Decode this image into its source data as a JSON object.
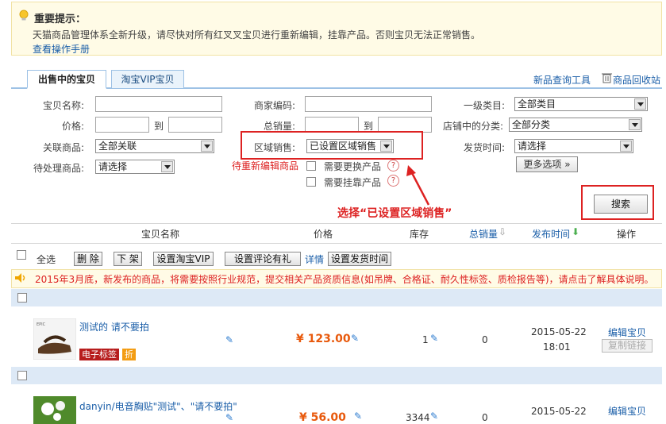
{
  "notice": {
    "title": "重要提示：",
    "text": "天猫商品管理体系全新升级，请尽快对所有红叉叉宝贝进行重新编辑，挂靠产品。否则宝贝无法正常销售。",
    "link": "查看操作手册"
  },
  "tabs": [
    {
      "label": "出售中的宝贝"
    },
    {
      "label": "淘宝VIP宝贝"
    }
  ],
  "top_links": {
    "product_tool": "新品查询工具",
    "recycle": "商品回收站"
  },
  "filters": {
    "name_label": "宝贝名称:",
    "price_label": "价格:",
    "to1": "到",
    "related_label": "关联商品:",
    "related_value": "全部关联",
    "pending_label": "待处理商品:",
    "pending_value": "请选择",
    "merchant_code_label": "商家编码:",
    "total_sales_label": "总销量:",
    "to2": "到",
    "region_label": "区域销售:",
    "region_value": "已设置区域销售",
    "need_edit_label": "待重新编辑商品",
    "need_replace_label": "需要更换产品",
    "need_attach_label": "需要挂靠产品",
    "category_label": "一级类目:",
    "category_value": "全部类目",
    "shop_category_label": "店铺中的分类:",
    "shop_category_value": "全部分类",
    "ship_time_label": "发货时间:",
    "ship_time_value": "请选择",
    "more_options": "更多选项",
    "search_button": "搜索"
  },
  "annotation": "选择“已设置区域销售”",
  "table": {
    "headers": {
      "name": "宝贝名称",
      "price": "价格",
      "stock": "库存",
      "total_sales": "总销量",
      "publish_time": "发布时间",
      "ops": "操作"
    }
  },
  "actions": {
    "select_all": "全选",
    "delete": "删 除",
    "shelve": "下 架",
    "set_vip": "设置淘宝VIP",
    "set_review": "设置评论有礼",
    "detail": "详情",
    "set_ship_time": "设置发货时间"
  },
  "warning": "2015年3月底，新发布的商品，将需要按照行业规范，提交相关产品资质信息(如吊牌、合格证、耐久性标签、质检报告等)，请点击了解具体说明。",
  "products": [
    {
      "name": "测试的 请不要拍",
      "price": "¥ 123.00",
      "stock": "1",
      "sales": "0",
      "date": "2015-05-22",
      "time": "18:01",
      "edit": "编辑宝贝",
      "copy": "复制链接",
      "tag_e": "电子标签",
      "tag_discount": "折"
    },
    {
      "name": "danyin/电音胸贴\"测试\"、\"请不要拍\"",
      "price": "¥ 56.00",
      "stock": "3344",
      "sales": "0",
      "date": "2015-05-22",
      "edit": "编辑宝贝"
    }
  ],
  "colors": {
    "accent_red": "#d22222",
    "link_blue": "#1a5ea8",
    "price_orange": "#e8590c",
    "notice_bg": "#fffbe6"
  }
}
